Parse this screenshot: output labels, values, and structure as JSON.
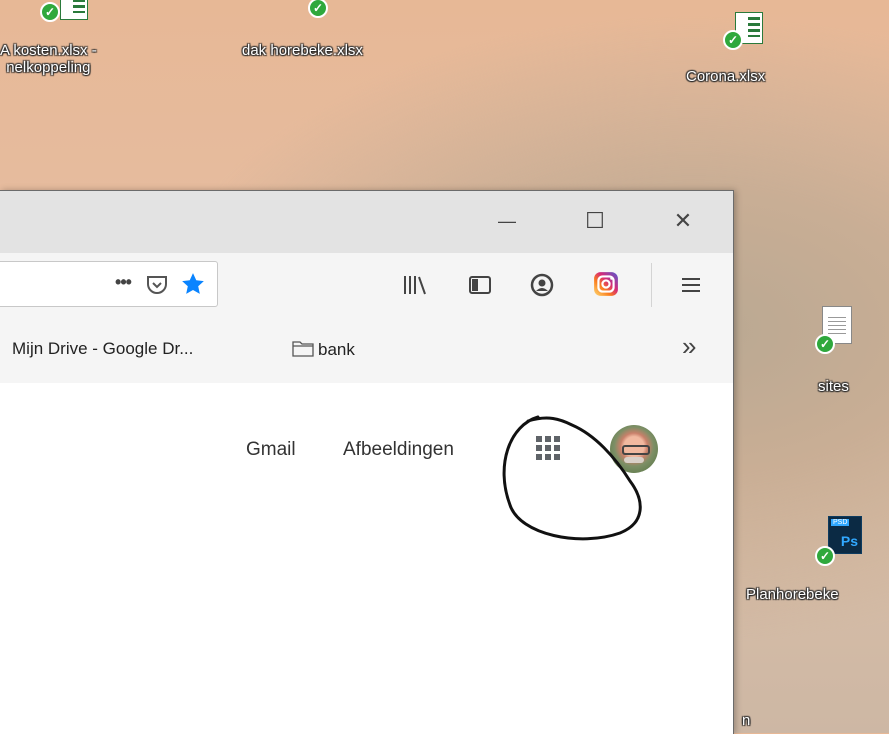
{
  "desktop": {
    "icons": [
      {
        "label": "A kosten.xlsx -\nnelkoppeling",
        "line1": "A kosten.xlsx -",
        "line2": "nelkoppeling",
        "type": "xlsx-shortcut"
      },
      {
        "label": "dak horebeke.xlsx",
        "type": "xlsx"
      },
      {
        "label": "Corona.xlsx",
        "type": "xlsx"
      },
      {
        "label": "sites",
        "type": "document"
      },
      {
        "label": "Planhorebeke",
        "type": "psd"
      },
      {
        "label": "n",
        "type": "partial"
      }
    ]
  },
  "window": {
    "controls": {
      "minimize": "—",
      "maximize": "☐",
      "close": "✕"
    },
    "navbar": {
      "page_actions": [
        "more-icon",
        "pocket-icon",
        "bookmark-star-icon"
      ],
      "toolbar_icons": [
        "library-icon",
        "sidebar-icon",
        "account-icon",
        "instagram-icon",
        "menu-icon"
      ],
      "overflow": "»"
    },
    "bookmarks": [
      {
        "label": "Mijn Drive - Google Dr..."
      },
      {
        "label": "bank",
        "icon": "folder-icon"
      }
    ],
    "accent": {
      "star": "#0a84ff",
      "instagram": "#d62976"
    }
  },
  "google": {
    "links": [
      "Gmail",
      "Afbeeldingen"
    ],
    "apps_icon": "apps-grid-icon",
    "avatar": "avatar"
  }
}
